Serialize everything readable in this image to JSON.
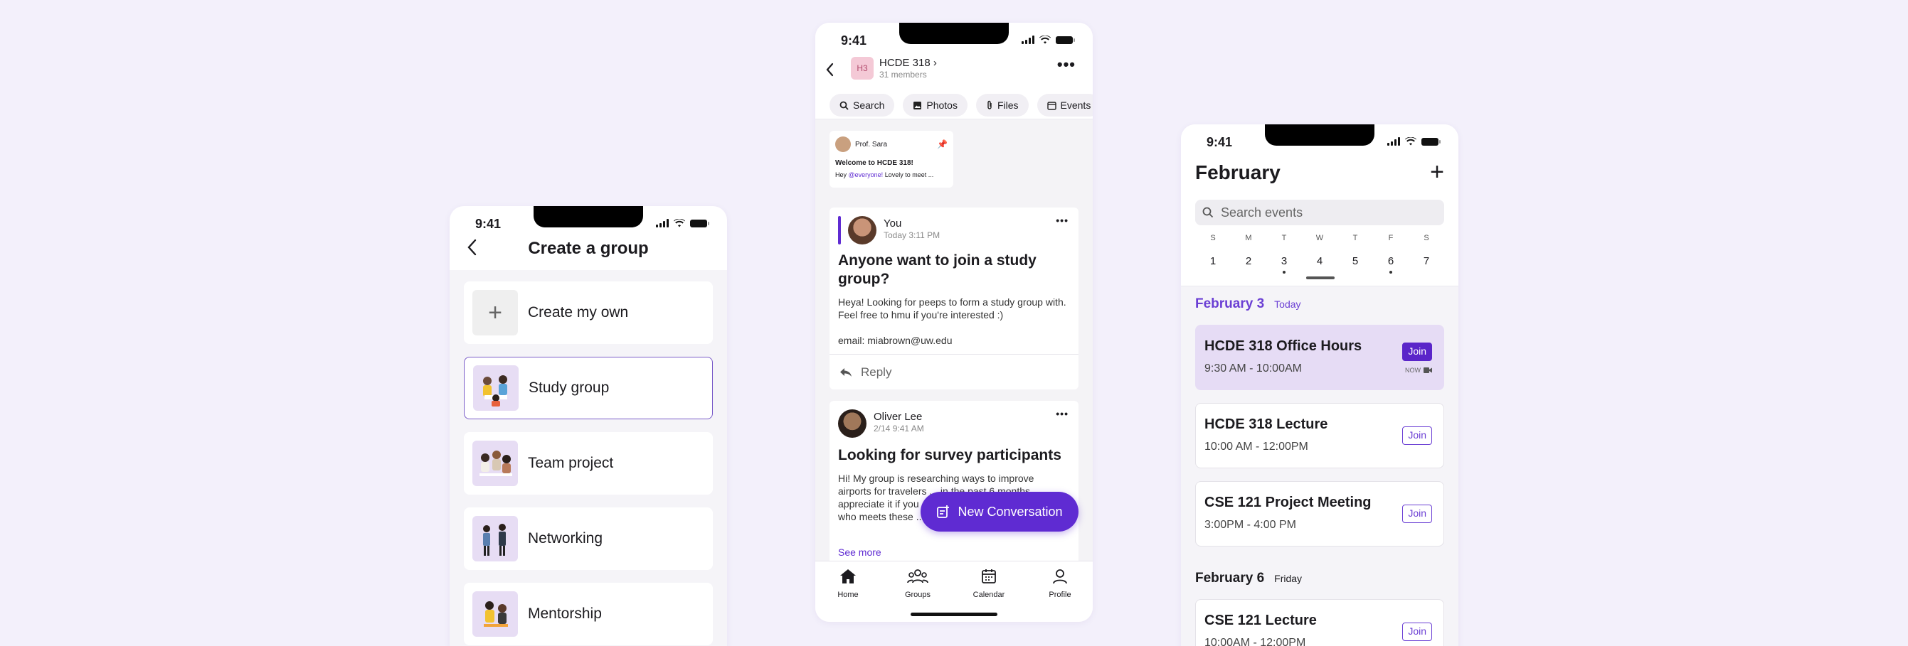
{
  "status_time": "9:41",
  "create_group": {
    "title": "Create a group",
    "options": [
      {
        "label": "Create my own",
        "icon": "plus-icon"
      },
      {
        "label": "Study group",
        "icon": "study-illustration"
      },
      {
        "label": "Team project",
        "icon": "team-illustration"
      },
      {
        "label": "Networking",
        "icon": "networking-illustration"
      },
      {
        "label": "Mentorship",
        "icon": "mentorship-illustration"
      }
    ],
    "selected": "Study group",
    "accent": "#7a5cc9"
  },
  "group_chat": {
    "avatar_initials": "H3",
    "name": "HCDE 318",
    "members": "31 members",
    "chips": [
      "Search",
      "Photos",
      "Files",
      "Events"
    ],
    "pinned": {
      "author": "Prof. Sara",
      "title": "Welcome to HCDE 318!",
      "mention": "@everyone!",
      "preview_prefix": "Hey ",
      "preview_suffix": " Lovely to meet ..."
    },
    "posts": [
      {
        "author": "You",
        "time": "Today 3:11 PM",
        "title": "Anyone want to join a study group?",
        "body": "Heya! Looking for peeps to form a study group with. Feel free to hmu if you're interested :)",
        "extra": "email: miabrown@uw.edu",
        "reply_label": "Reply"
      },
      {
        "author": "Oliver Lee",
        "time": "2/14 9:41 AM",
        "title": "Looking for survey participants",
        "body": "Hi! My group is researching ways to improve airports for travelers ... in the past 6 months ... appreciate it if you ... on to anyone you know who meets these ...",
        "see_more": "See more"
      }
    ],
    "fab_label": "New Conversation",
    "fab_color": "#5f2bd2",
    "tabs": [
      {
        "label": "Home",
        "icon": "home-icon"
      },
      {
        "label": "Groups",
        "icon": "groups-icon"
      },
      {
        "label": "Calendar",
        "icon": "calendar-icon"
      },
      {
        "label": "Profile",
        "icon": "profile-icon"
      }
    ]
  },
  "calendar": {
    "month": "February",
    "search_placeholder": "Search events",
    "weekdays": [
      "S",
      "M",
      "T",
      "W",
      "T",
      "F",
      "S"
    ],
    "days": [
      "1",
      "2",
      "3",
      "4",
      "5",
      "6",
      "7"
    ],
    "today_index": 2,
    "sections": [
      {
        "date": "February 3",
        "label": "Today",
        "events": [
          {
            "title": "HCDE 318 Office Hours",
            "time": "9:30 AM - 10:00AM",
            "join": "Join",
            "badge": "NOW"
          },
          {
            "title": "HCDE 318 Lecture",
            "time": "10:00 AM - 12:00PM",
            "join": "Join"
          },
          {
            "title": "CSE 121 Project Meeting",
            "time": "3:00PM - 4:00 PM",
            "join": "Join"
          }
        ]
      },
      {
        "date": "February 6",
        "label": "Friday",
        "events": [
          {
            "title": "CSE 121 Lecture",
            "time": "10:00AM - 12:00PM",
            "join": "Join"
          }
        ]
      }
    ],
    "accent": "#6b3fd4",
    "highlight": "#e6dcf5"
  }
}
